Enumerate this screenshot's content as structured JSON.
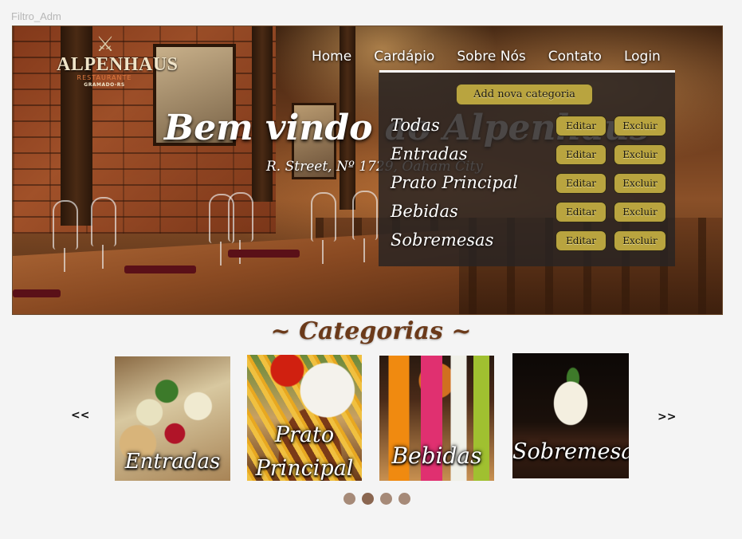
{
  "frame_label": "Filtro_Adm",
  "logo": {
    "name": "ALPENHAUS",
    "subtitle": "RESTAURANTE",
    "city": "GRAMADO-RS",
    "icon": "fork-knife-icon"
  },
  "nav": {
    "items": [
      {
        "label": "Home"
      },
      {
        "label": "Cardápio"
      },
      {
        "label": "Sobre Nós"
      },
      {
        "label": "Contato"
      },
      {
        "label": "Login"
      }
    ]
  },
  "hero": {
    "title": "Bem vindo ao Alpenhaus",
    "address": "R. Street, Nº 1729, Oaham City"
  },
  "dropdown": {
    "add_button": "Add nova categoria",
    "categories": [
      {
        "name": "Todas",
        "edit": "Editar",
        "delete": "Excluir"
      },
      {
        "name": "Entradas",
        "edit": "Editar",
        "delete": "Excluir"
      },
      {
        "name": "Prato Principal",
        "edit": "Editar",
        "delete": "Excluir"
      },
      {
        "name": "Bebidas",
        "edit": "Editar",
        "delete": "Excluir"
      },
      {
        "name": "Sobremesas",
        "edit": "Editar",
        "delete": "Excluir"
      }
    ]
  },
  "categories_section": {
    "heading": "~ Categorias ~",
    "prev": "<<",
    "next": ">>",
    "cards": [
      {
        "label": "Entradas"
      },
      {
        "label": "Prato Principal"
      },
      {
        "label": "Bebidas"
      },
      {
        "label": "Sobremesa"
      }
    ],
    "dots": 4,
    "active_dot": 1
  },
  "colors": {
    "button_gold": "#b9a43f",
    "heading_brown": "#6b3a1a",
    "dot": "#a68a78",
    "dot_active": "#8a6650"
  }
}
